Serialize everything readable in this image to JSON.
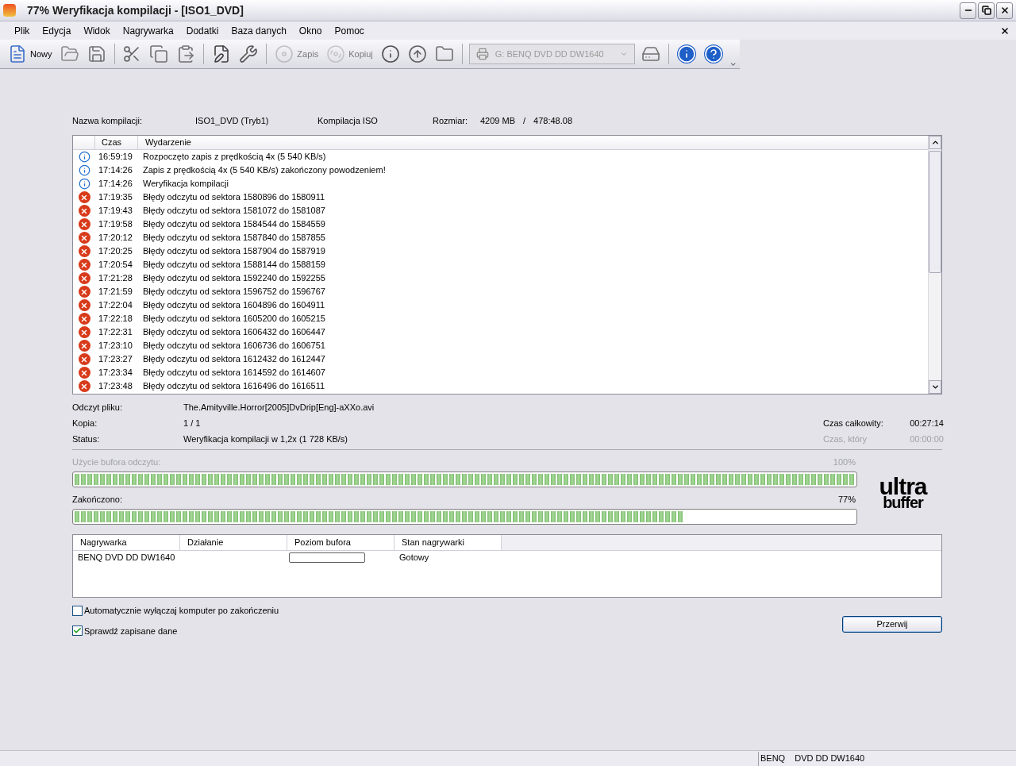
{
  "window": {
    "title": "77% Weryfikacja kompilacji - [ISO1_DVD]"
  },
  "menu": [
    "Plik",
    "Edycja",
    "Widok",
    "Nagrywarka",
    "Dodatki",
    "Baza danych",
    "Okno",
    "Pomoc"
  ],
  "toolbar": [
    {
      "kind": "button",
      "label": "Nowy",
      "disabled": false
    },
    {
      "kind": "button",
      "disabled": false
    },
    {
      "kind": "button",
      "disabled": false
    },
    {
      "kind": "separator"
    },
    {
      "kind": "button",
      "disabled": false
    },
    {
      "kind": "button",
      "disabled": false
    },
    {
      "kind": "button",
      "disabled": false
    },
    {
      "kind": "separator"
    },
    {
      "kind": "button",
      "disabled": false
    },
    {
      "kind": "button",
      "disabled": false
    },
    {
      "kind": "separator"
    },
    {
      "kind": "button",
      "label": "Zapis",
      "disabled": true
    },
    {
      "kind": "button",
      "label": "Kopiuj",
      "disabled": true
    },
    {
      "kind": "button",
      "disabled": false
    },
    {
      "kind": "button",
      "disabled": false
    },
    {
      "kind": "button",
      "disabled": false
    },
    {
      "kind": "separator"
    },
    {
      "kind": "combo",
      "value": "G: BENQ DVD DD DW1640",
      "disabled": true
    },
    {
      "kind": "button",
      "disabled": false
    },
    {
      "kind": "separator"
    },
    {
      "kind": "button",
      "disabled": false
    },
    {
      "kind": "button",
      "disabled": false
    }
  ],
  "summary": {
    "name_label": "Nazwa kompilacji:",
    "name": "ISO1_DVD (Tryb1)",
    "type": "Kompilacja ISO",
    "size_label": "Rozmiar:",
    "size": "4209 MB",
    "separator": "/",
    "duration": "478:48.08"
  },
  "log": {
    "columns": [
      "Czas",
      "Wydarzenie"
    ],
    "rows": [
      {
        "kind": "info",
        "time": "16:59:19",
        "event": "Rozpoczęto zapis z prędkością 4x (5 540 KB/s)"
      },
      {
        "kind": "info",
        "time": "17:14:26",
        "event": "Zapis z prędkością 4x (5 540 KB/s) zakończony powodzeniem!"
      },
      {
        "kind": "info",
        "time": "17:14:26",
        "event": "Weryfikacja kompilacji"
      },
      {
        "kind": "error",
        "time": "17:19:35",
        "event": "Błędy odczytu od sektora 1580896 do 1580911"
      },
      {
        "kind": "error",
        "time": "17:19:43",
        "event": "Błędy odczytu od sektora 1581072 do 1581087"
      },
      {
        "kind": "error",
        "time": "17:19:58",
        "event": "Błędy odczytu od sektora 1584544 do 1584559"
      },
      {
        "kind": "error",
        "time": "17:20:12",
        "event": "Błędy odczytu od sektora 1587840 do 1587855"
      },
      {
        "kind": "error",
        "time": "17:20:25",
        "event": "Błędy odczytu od sektora 1587904 do 1587919"
      },
      {
        "kind": "error",
        "time": "17:20:54",
        "event": "Błędy odczytu od sektora 1588144 do 1588159"
      },
      {
        "kind": "error",
        "time": "17:21:28",
        "event": "Błędy odczytu od sektora 1592240 do 1592255"
      },
      {
        "kind": "error",
        "time": "17:21:59",
        "event": "Błędy odczytu od sektora 1596752 do 1596767"
      },
      {
        "kind": "error",
        "time": "17:22:04",
        "event": "Błędy odczytu od sektora 1604896 do 1604911"
      },
      {
        "kind": "error",
        "time": "17:22:18",
        "event": "Błędy odczytu od sektora 1605200 do 1605215"
      },
      {
        "kind": "error",
        "time": "17:22:31",
        "event": "Błędy odczytu od sektora 1606432 do 1606447"
      },
      {
        "kind": "error",
        "time": "17:23:10",
        "event": "Błędy odczytu od sektora 1606736 do 1606751"
      },
      {
        "kind": "error",
        "time": "17:23:27",
        "event": "Błędy odczytu od sektora 1612432 do 1612447"
      },
      {
        "kind": "error",
        "time": "17:23:34",
        "event": "Błędy odczytu od sektora 1614592 do 1614607"
      },
      {
        "kind": "error",
        "time": "17:23:48",
        "event": "Błędy odczytu od sektora 1616496 do 1616511"
      }
    ]
  },
  "details": [
    {
      "label": "Odczyt pliku:",
      "value": "The.Amityville.Horror[2005]DvDrip[Eng]-aXXo.avi"
    },
    {
      "label": "Kopia:",
      "value": "1 / 1",
      "side_label": "Czas całkowity:",
      "side_value": "00:27:14",
      "side_disabled": false
    },
    {
      "label": "Status:",
      "value": "Weryfikacja kompilacji w 1,2x (1 728 KB/s)",
      "side_label": "Czas, który",
      "side_value": "00:00:00",
      "side_disabled": true
    }
  ],
  "read_buffer": {
    "label": "Użycie bufora odczytu:",
    "reading": "100%",
    "level": 1.0,
    "disabled": true
  },
  "progress": {
    "label": "Zakończono:",
    "reading": "77%",
    "level": 0.78,
    "disabled": false
  },
  "logo": [
    "ultra",
    "buffer"
  ],
  "drives": {
    "columns": [
      "Nagrywarka",
      "Działanie",
      "Poziom bufora",
      "Stan nagrywarki"
    ],
    "rows": [
      {
        "name": "BENQ DVD DD DW1640",
        "level": 0,
        "state": "Gotowy"
      }
    ]
  },
  "options": [
    {
      "label": "Automatycznie wyłączaj komputer po zakończeniu",
      "checked": false
    },
    {
      "label": "Sprawdź zapisane dane",
      "checked": true
    }
  ],
  "abort_button": "Przerwij",
  "status_bar": [
    "BENQ",
    "DVD DD DW1640"
  ]
}
